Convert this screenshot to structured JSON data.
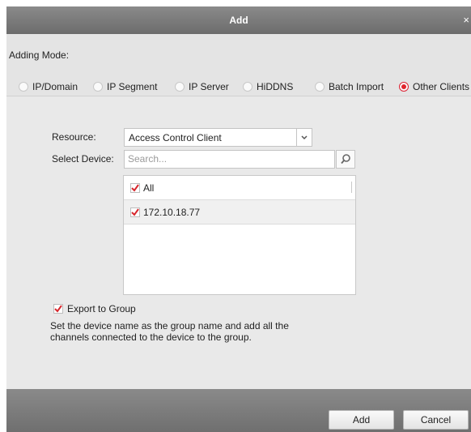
{
  "dialog": {
    "title": "Add",
    "close_glyph": "×"
  },
  "adding_mode": {
    "label": "Adding Mode:",
    "options": [
      "IP/Domain",
      "IP Segment",
      "IP Server",
      "HiDDNS",
      "Batch Import",
      "Other Clients"
    ],
    "selected": "Other Clients"
  },
  "resource": {
    "label": "Resource:",
    "value": "Access Control Client"
  },
  "select_device": {
    "label": "Select Device:",
    "placeholder": "Search..."
  },
  "device_list": {
    "items": [
      {
        "label": "All",
        "checked": true
      },
      {
        "label": "172.10.18.77",
        "checked": true
      }
    ]
  },
  "export_group": {
    "label": "Export to Group",
    "checked": true,
    "description_line1": "Set the device name as the group name and add all the",
    "description_line2": "channels connected to the device to the group."
  },
  "footer": {
    "add_label": "Add",
    "cancel_label": "Cancel"
  },
  "colors": {
    "accent": "#e0252c",
    "titlebar": "#7a7a7a",
    "body": "#e9e9e9"
  },
  "icons": {
    "search": "magnifier-icon",
    "dropdown": "chevron-down-icon",
    "check": "checkmark-icon"
  }
}
